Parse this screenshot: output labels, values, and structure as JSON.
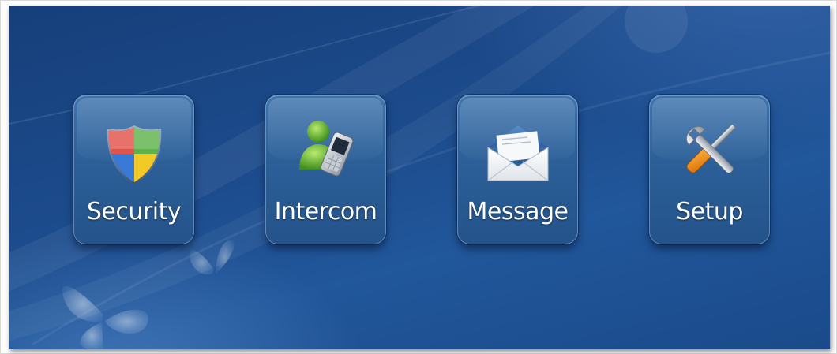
{
  "home": {
    "tiles": [
      {
        "label": "Security",
        "icon": "shield-icon"
      },
      {
        "label": "Intercom",
        "icon": "messenger-phone-icon"
      },
      {
        "label": "Message",
        "icon": "envelope-icon"
      },
      {
        "label": "Setup",
        "icon": "wrench-screwdriver-icon"
      }
    ]
  },
  "colors": {
    "background": "#1c4b8c",
    "tile": "#2c5f98",
    "label": "#ffffff"
  }
}
